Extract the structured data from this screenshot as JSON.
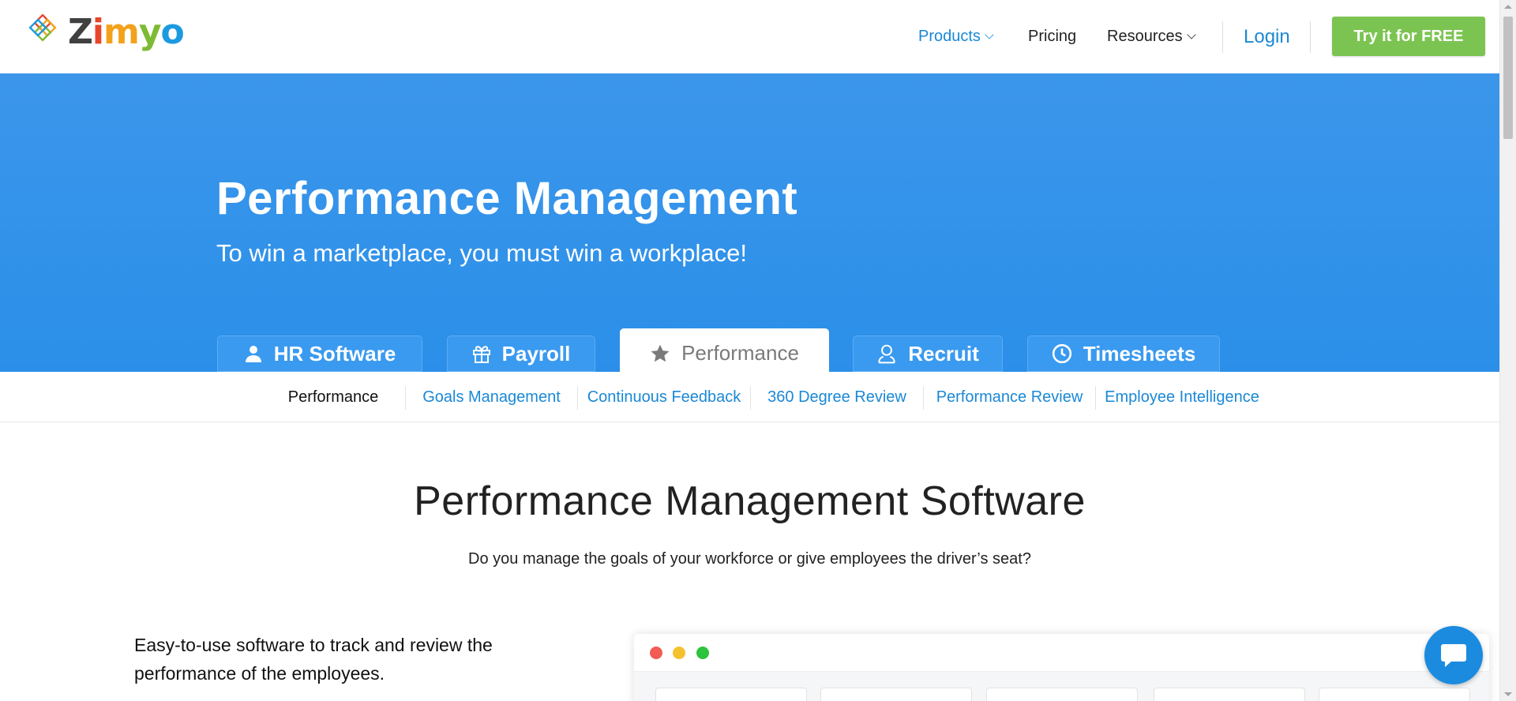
{
  "brand": {
    "logo_letters": [
      "Z",
      "i",
      "m",
      "y",
      "o"
    ]
  },
  "nav": {
    "products": "Products",
    "pricing": "Pricing",
    "resources": "Resources",
    "login": "Login",
    "cta": "Try it for FREE"
  },
  "hero": {
    "title": "Performance Management",
    "subtitle": "To win a marketplace, you must win a workplace!"
  },
  "product_tabs": [
    {
      "label": "HR Software",
      "icon": "person-icon",
      "active": false
    },
    {
      "label": "Payroll",
      "icon": "gift-icon",
      "active": false
    },
    {
      "label": "Performance",
      "icon": "star-icon",
      "active": true
    },
    {
      "label": "Recruit",
      "icon": "user-outline-icon",
      "active": false
    },
    {
      "label": "Timesheets",
      "icon": "clock-icon",
      "active": false
    }
  ],
  "subnav": [
    {
      "label": "Performance",
      "current": true
    },
    {
      "label": "Goals Management",
      "current": false
    },
    {
      "label": "Continuous Feedback",
      "current": false
    },
    {
      "label": "360 Degree Review",
      "current": false
    },
    {
      "label": "Performance Review",
      "current": false
    },
    {
      "label": "Employee Intelligence",
      "current": false
    }
  ],
  "section": {
    "title": "Performance Management Software",
    "subtitle": "Do you manage the goals of your workforce or give employees the driver’s seat?",
    "description": "Easy-to-use software to track and review the performance of the employees."
  },
  "colors": {
    "primary_blue": "#2b8fe9",
    "link_blue": "#1a88d6",
    "cta_green": "#7cc452",
    "window_dot_red": "#f25c54",
    "window_dot_yellow": "#f5c12e",
    "window_dot_green": "#2cc33d"
  },
  "widgets": {
    "chat_button_icon": "chat-bubble-icon"
  }
}
